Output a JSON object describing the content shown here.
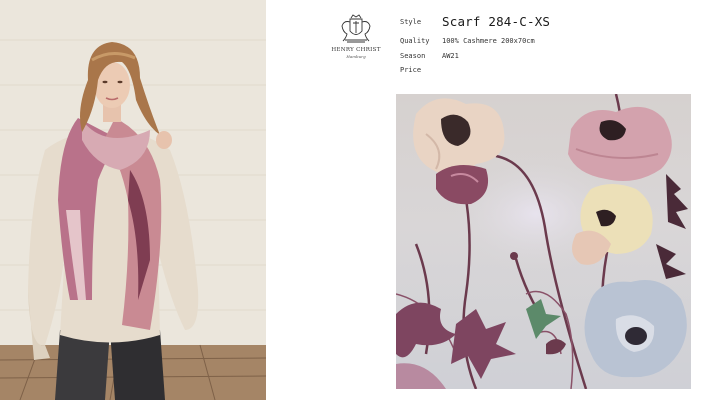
{
  "brand": {
    "name": "HENRY CHRIST",
    "city": "Hamburg",
    "logo_icon": "coat-of-arms-icon"
  },
  "specs": [
    {
      "label": "Style",
      "value": "Scarf 284-C-XS"
    },
    {
      "label": "Quality",
      "value": "100% Cashmere 200x70cm"
    },
    {
      "label": "Season",
      "value": "AW21"
    },
    {
      "label": "Price",
      "value": ""
    }
  ],
  "colors": {
    "accent_pink": "#c98a93",
    "plum": "#6b3a4d",
    "cream": "#e9dcc8",
    "pale_blue": "#b9c3d3"
  }
}
